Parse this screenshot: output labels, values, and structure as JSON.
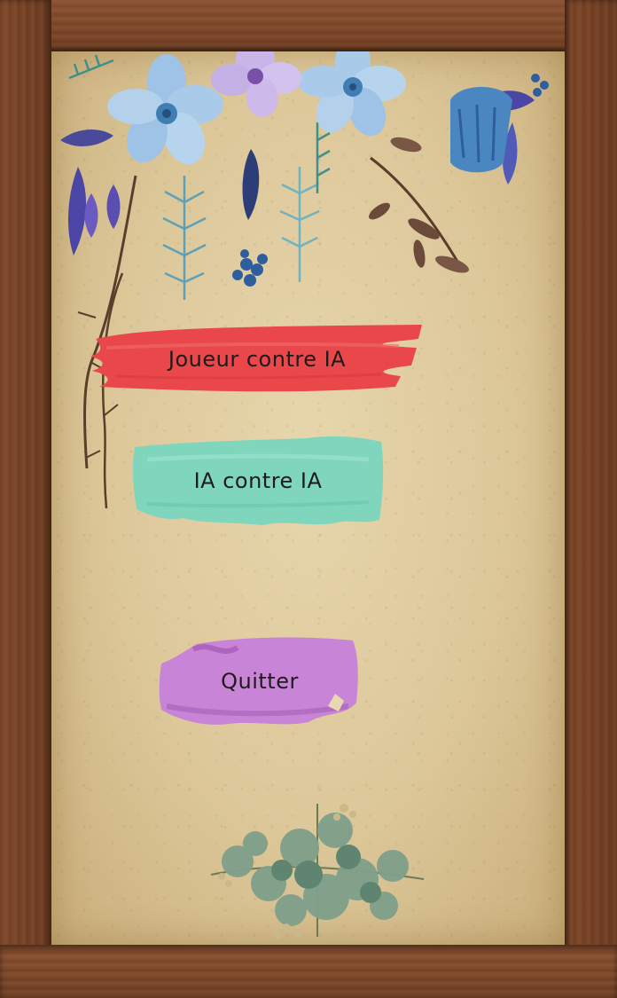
{
  "menu": {
    "player_vs_ai_label": "Joueur contre IA",
    "ai_vs_ai_label": "IA contre IA",
    "quit_label": "Quitter"
  },
  "decor": {
    "top_decoration": "watercolor-flowers-icon",
    "bottom_decoration": "eucalyptus-branch-icon",
    "frame": "wooden-frame"
  },
  "colors": {
    "paper": "#dcc799",
    "frame_wood": "#6b3b20",
    "player_button": "#e9474a",
    "ai_button": "#7fd6bd",
    "quit_button": "#c884d6",
    "label_text": "#1e1b1c"
  }
}
